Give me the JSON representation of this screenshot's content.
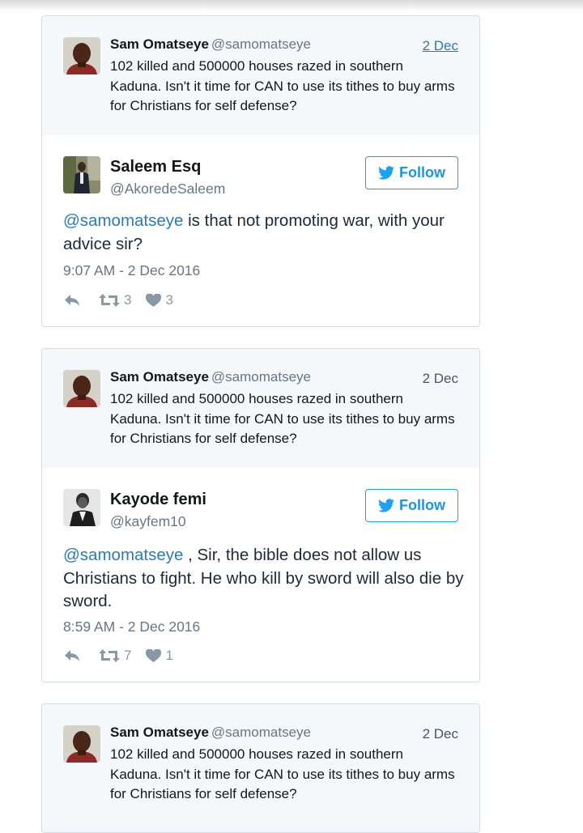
{
  "quoted_tweet": {
    "name": "Sam Omatseye",
    "handle": "@samomatseye",
    "date": "2 Dec",
    "text": "102 killed and 500000 houses razed in southern Kaduna. Isn't it time for CAN to use its tithes to buy arms for Christians for self defense?"
  },
  "follow_label": "Follow",
  "replies": [
    {
      "name": "Saleem Esq",
      "handle": "@AkoredeSaleem",
      "mention": "@samomatseye",
      "text": " is that not promoting war, with your advice sir?",
      "time": "9:07 AM - 2 Dec 2016",
      "retweets": "3",
      "likes": "3"
    },
    {
      "name": "Kayode femi",
      "handle": "@kayfem10",
      "mention": "@samomatseye",
      "text": " , Sir, the bible does not allow us Christians to fight. He who kill by sword will also die by sword.",
      "time": "8:59 AM - 2 Dec 2016",
      "retweets": "7",
      "likes": "1"
    }
  ],
  "icons": {
    "reply": "reply-icon",
    "retweet": "retweet-icon",
    "like": "heart-icon",
    "bird": "twitter-bird-icon"
  },
  "colors": {
    "link": "#2b7bb9",
    "follow": "#1da1f2",
    "muted": "#657786"
  }
}
